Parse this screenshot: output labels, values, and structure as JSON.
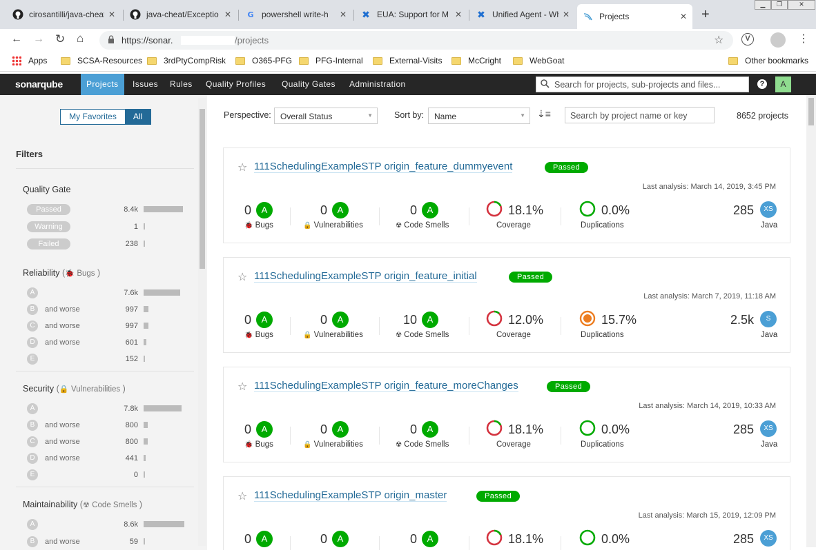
{
  "browser": {
    "tabs": [
      {
        "label": "cirosantilli/java-cheat",
        "icon": "github-icon"
      },
      {
        "label": "java-cheat/Exceptio",
        "icon": "github-icon"
      },
      {
        "label": "powershell write-h",
        "icon": "google-icon"
      },
      {
        "label": "EUA: Support for M",
        "icon": "confluence-icon"
      },
      {
        "label": "Unified Agent - Wh",
        "icon": "confluence-icon"
      },
      {
        "label": "Projects",
        "icon": "sonarqube-icon"
      }
    ],
    "url": "https://sonar.",
    "url_path": "/projects",
    "bookmarks": [
      "Apps",
      "SCSA-Resources",
      "3rdPtyCompRisk",
      "O365-PFG",
      "PFG-Internal",
      "External-Visits",
      "McCright",
      "WebGoat"
    ],
    "other_bookmarks": "Other bookmarks"
  },
  "nav": {
    "logo_a": "sonar",
    "logo_b": "qube",
    "items": [
      "Projects",
      "Issues",
      "Rules",
      "Quality Profiles",
      "Quality Gates",
      "Administration"
    ],
    "search_placeholder": "Search for projects, sub-projects and files...",
    "help": "?",
    "avatar": "A"
  },
  "sidebar": {
    "toggle": [
      "My Favorites",
      "All"
    ],
    "filters_title": "Filters",
    "quality_gate": {
      "title": "Quality Gate",
      "rows": [
        {
          "label": "Passed",
          "count": "8.4k",
          "bar": 0.97
        },
        {
          "label": "Warning",
          "count": "1",
          "bar": 0.0
        },
        {
          "label": "Failed",
          "count": "238",
          "bar": 0.03
        }
      ]
    },
    "reliability": {
      "title": "Reliability",
      "sub": "Bugs",
      "rows": [
        {
          "grade": "A",
          "label": "",
          "count": "7.6k",
          "bar": 0.9
        },
        {
          "grade": "B",
          "label": "and worse",
          "count": "997",
          "bar": 0.12
        },
        {
          "grade": "C",
          "label": "and worse",
          "count": "997",
          "bar": 0.12
        },
        {
          "grade": "D",
          "label": "and worse",
          "count": "601",
          "bar": 0.07
        },
        {
          "grade": "E",
          "label": "",
          "count": "152",
          "bar": 0.02
        }
      ]
    },
    "security": {
      "title": "Security",
      "sub": "Vulnerabilities",
      "rows": [
        {
          "grade": "A",
          "label": "",
          "count": "7.8k",
          "bar": 0.93
        },
        {
          "grade": "B",
          "label": "and worse",
          "count": "800",
          "bar": 0.1
        },
        {
          "grade": "C",
          "label": "and worse",
          "count": "800",
          "bar": 0.1
        },
        {
          "grade": "D",
          "label": "and worse",
          "count": "441",
          "bar": 0.05
        },
        {
          "grade": "E",
          "label": "",
          "count": "0",
          "bar": 0.0
        }
      ]
    },
    "maintainability": {
      "title": "Maintainability",
      "sub": "Code Smells",
      "rows": [
        {
          "grade": "A",
          "label": "",
          "count": "8.6k",
          "bar": 1.0
        },
        {
          "grade": "B",
          "label": "and worse",
          "count": "59",
          "bar": 0.01
        }
      ]
    }
  },
  "toolbar": {
    "perspective_label": "Perspective:",
    "perspective_value": "Overall Status",
    "sort_label": "Sort by:",
    "sort_value": "Name",
    "search_placeholder": "Search by project name or key",
    "project_count": "8652 projects"
  },
  "projects": [
    {
      "name": "111SchedulingExampleSTP origin_feature_dummyevent",
      "gate": "Passed",
      "last": "Last analysis: March 14, 2019, 3:45 PM",
      "bugs": "0",
      "vulns": "0",
      "smells": "0",
      "coverage": "18.1%",
      "duplications": "0.0%",
      "size": "285",
      "size_badge": "XS",
      "lang": "Java",
      "dup_state": "good"
    },
    {
      "name": "111SchedulingExampleSTP origin_feature_initial",
      "gate": "Passed",
      "last": "Last analysis: March 7, 2019, 11:18 AM",
      "bugs": "0",
      "vulns": "0",
      "smells": "10",
      "coverage": "12.0%",
      "duplications": "15.7%",
      "size": "2.5k",
      "size_badge": "S",
      "lang": "Java",
      "dup_state": "bad"
    },
    {
      "name": "111SchedulingExampleSTP origin_feature_moreChanges",
      "gate": "Passed",
      "last": "Last analysis: March 14, 2019, 10:33 AM",
      "bugs": "0",
      "vulns": "0",
      "smells": "0",
      "coverage": "18.1%",
      "duplications": "0.0%",
      "size": "285",
      "size_badge": "XS",
      "lang": "Java",
      "dup_state": "good"
    },
    {
      "name": "111SchedulingExampleSTP origin_master",
      "gate": "Passed",
      "last": "Last analysis: March 15, 2019, 12:09 PM",
      "bugs": "0",
      "vulns": "0",
      "smells": "0",
      "coverage": "18.1%",
      "duplications": "0.0%",
      "size": "285",
      "size_badge": "XS",
      "lang": "",
      "dup_state": "good"
    }
  ],
  "labels": {
    "bugs": "Bugs",
    "vulns": "Vulnerabilities",
    "smells": "Code Smells",
    "coverage": "Coverage",
    "duplications": "Duplications",
    "grade": "A"
  },
  "colors": {
    "accent": "#4b9fd5",
    "passed": "#00aa00",
    "nav_bg": "#262626",
    "coverage_red": "#d4333f",
    "dup_orange": "#ed7d20"
  }
}
